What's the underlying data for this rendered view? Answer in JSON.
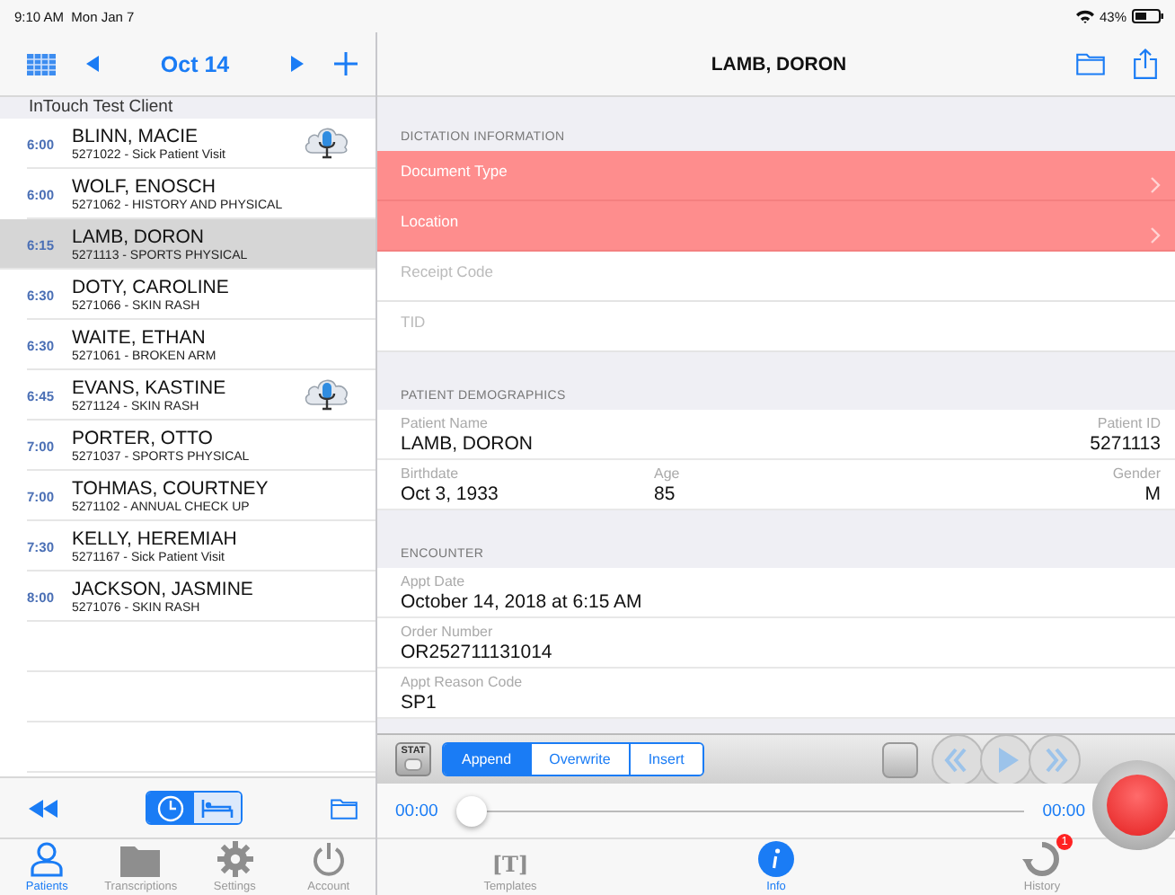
{
  "status_bar": {
    "time": "9:10 AM",
    "date": "Mon Jan 7",
    "battery": "43%"
  },
  "schedule": {
    "date": "Oct 14",
    "client": "InTouch Test Client",
    "appointments": [
      {
        "time": "6:00",
        "name": "BLINN, MACIE",
        "detail": "5271022 - Sick Patient Visit",
        "selected": false,
        "has_dictation": true
      },
      {
        "time": "6:00",
        "name": "WOLF, ENOSCH",
        "detail": "5271062 - HISTORY AND PHYSICAL",
        "selected": false,
        "has_dictation": false
      },
      {
        "time": "6:15",
        "name": "LAMB, DORON",
        "detail": "5271113 - SPORTS PHYSICAL",
        "selected": true,
        "has_dictation": false
      },
      {
        "time": "6:30",
        "name": "DOTY, CAROLINE",
        "detail": "5271066 - SKIN RASH",
        "selected": false,
        "has_dictation": false
      },
      {
        "time": "6:30",
        "name": "WAITE, ETHAN",
        "detail": "5271061 - BROKEN ARM",
        "selected": false,
        "has_dictation": false
      },
      {
        "time": "6:45",
        "name": "EVANS, KASTINE",
        "detail": "5271124 - SKIN RASH",
        "selected": false,
        "has_dictation": true
      },
      {
        "time": "7:00",
        "name": "PORTER, OTTO",
        "detail": "5271037 - SPORTS PHYSICAL",
        "selected": false,
        "has_dictation": false
      },
      {
        "time": "7:00",
        "name": "TOHMAS, COURTNEY",
        "detail": "5271102 - ANNUAL CHECK UP",
        "selected": false,
        "has_dictation": false
      },
      {
        "time": "7:30",
        "name": "KELLY, HEREMIAH",
        "detail": "5271167 - Sick Patient Visit",
        "selected": false,
        "has_dictation": false
      },
      {
        "time": "8:00",
        "name": "JACKSON, JASMINE",
        "detail": "5271076 - SKIN RASH",
        "selected": false,
        "has_dictation": false
      }
    ],
    "view_toggle": [
      {
        "kind": "clock",
        "selected": true
      },
      {
        "kind": "bed",
        "selected": false
      }
    ]
  },
  "main_tabs": [
    {
      "kind": "person",
      "label": "Patients",
      "selected": true
    },
    {
      "kind": "folder",
      "label": "Transcriptions",
      "selected": false
    },
    {
      "kind": "gear",
      "label": "Settings",
      "selected": false
    },
    {
      "kind": "power",
      "label": "Account",
      "selected": false
    }
  ],
  "detail": {
    "title": "LAMB, DORON",
    "sections": [
      {
        "title": "DICTATION INFORMATION",
        "kind": "dictation",
        "rows": [
          {
            "label": "Document Type",
            "required": true
          },
          {
            "label": "Location",
            "required": true
          },
          {
            "label": "Receipt Code",
            "required": false
          },
          {
            "label": "TID",
            "required": false
          }
        ]
      },
      {
        "title": "PATIENT DEMOGRAPHICS",
        "kind": "fields",
        "rows": [
          [
            {
              "label": "Patient Name",
              "value": "LAMB, DORON"
            },
            null,
            {
              "label": "Patient ID",
              "value": "5271113"
            }
          ],
          [
            {
              "label": "Birthdate",
              "value": "Oct 3, 1933"
            },
            {
              "label": "Age",
              "value": "85"
            },
            {
              "label": "Gender",
              "value": "M"
            }
          ]
        ]
      },
      {
        "title": "ENCOUNTER",
        "kind": "fields",
        "rows": [
          [
            {
              "label": "Appt Date",
              "value": "October 14, 2018 at 6:15 AM"
            }
          ],
          [
            {
              "label": "Order Number",
              "value": "OR252711131014"
            }
          ],
          [
            {
              "label": "Appt Reason Code",
              "value": "SP1"
            }
          ]
        ]
      }
    ]
  },
  "recorder": {
    "stat_label": "STAT",
    "modes": [
      {
        "label": "Append",
        "selected": true
      },
      {
        "label": "Overwrite",
        "selected": false
      },
      {
        "label": "Insert",
        "selected": false
      }
    ],
    "position": {
      "level": 0
    },
    "elapsed": "00:00",
    "total": "00:00"
  },
  "detail_tabs": [
    {
      "kind": "templates",
      "glyph": "[T]",
      "label": "Templates",
      "selected": false
    },
    {
      "kind": "info",
      "label": "Info",
      "selected": true
    },
    {
      "kind": "history",
      "label": "History",
      "selected": false,
      "badge": "1"
    }
  ]
}
